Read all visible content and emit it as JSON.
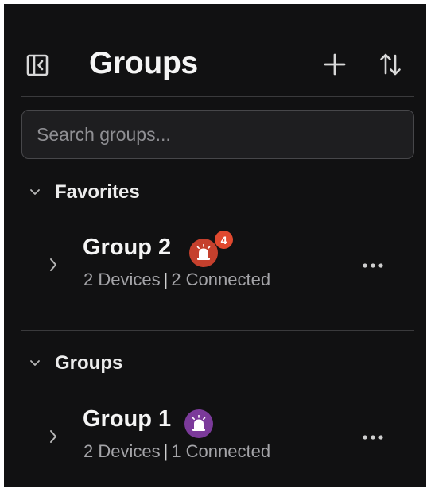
{
  "header": {
    "title": "Groups",
    "collapse_icon": "sidebar-collapse-icon",
    "add_icon": "plus-icon",
    "sort_icon": "sort-arrows-icon"
  },
  "search": {
    "placeholder": "Search groups...",
    "value": ""
  },
  "sections": [
    {
      "label": "Favorites",
      "expanded": true,
      "groups": [
        {
          "name": "Group 2",
          "devices": "2 Devices",
          "separator": "|",
          "connected": "2 Connected",
          "alarm_color": "#c5402d",
          "alarm_count": "4"
        }
      ]
    },
    {
      "label": "Groups",
      "expanded": true,
      "groups": [
        {
          "name": "Group 1",
          "devices": "2 Devices",
          "separator": "|",
          "connected": "1 Connected",
          "alarm_color": "#7b3a9a"
        }
      ]
    }
  ],
  "colors": {
    "panel_bg": "#111112",
    "divider": "#3a3a3c",
    "text_primary": "#f5f5f5",
    "text_secondary": "#a4a4a8",
    "alert_red": "#c5402d",
    "count_badge": "#e0492f",
    "alarm_purple": "#7b3a9a"
  }
}
